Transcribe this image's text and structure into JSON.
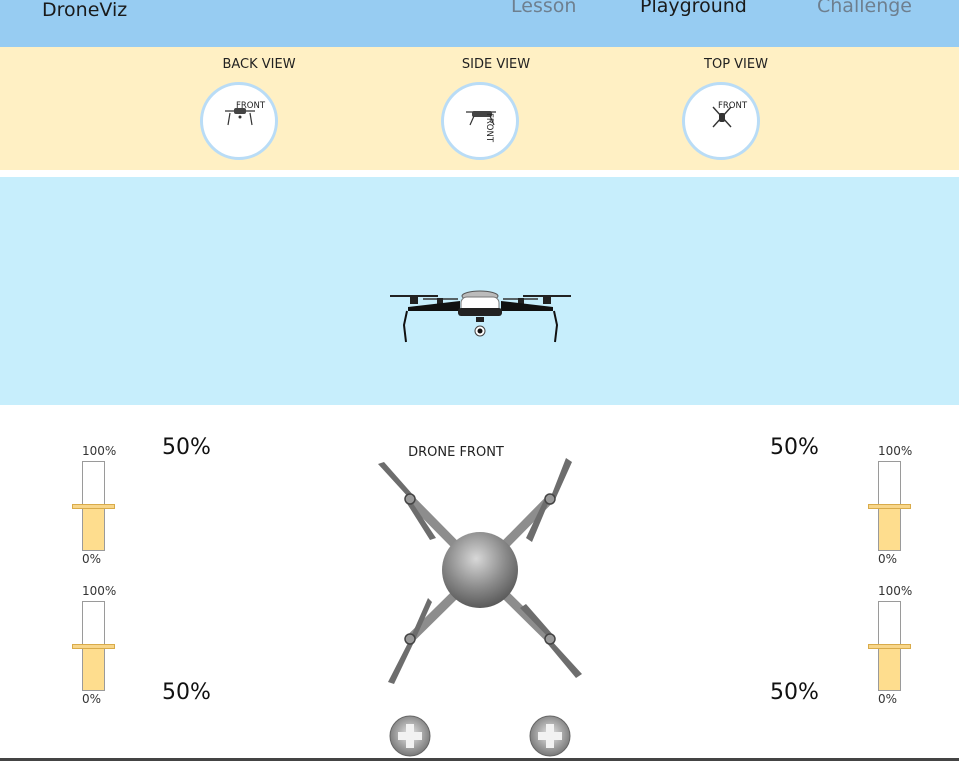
{
  "app": {
    "title": "DroneViz"
  },
  "nav": [
    {
      "label": "Lesson"
    },
    {
      "label": "Playground"
    },
    {
      "label": "Challenge"
    }
  ],
  "active_tab": "Playground",
  "views": {
    "back": {
      "title": "BACK VIEW",
      "front_label": "FRONT"
    },
    "side": {
      "title": "SIDE VIEW",
      "front_label": "FRONT"
    },
    "top": {
      "title": "TOP VIEW",
      "front_label": "FRONT"
    }
  },
  "controls": {
    "drone_front_label": "DRONE FRONT",
    "motors": {
      "front_left": {
        "value": 0.5,
        "percent_label": "50%",
        "max_label": "100%",
        "min_label": "0%"
      },
      "back_left": {
        "value": 0.5,
        "percent_label": "50%",
        "max_label": "100%",
        "min_label": "0%"
      },
      "front_right": {
        "value": 0.5,
        "percent_label": "50%",
        "max_label": "100%",
        "min_label": "0%"
      },
      "back_right": {
        "value": 0.5,
        "percent_label": "50%",
        "max_label": "100%",
        "min_label": "0%"
      }
    }
  },
  "colors": {
    "header": "#97ccf2",
    "views_strip": "#fff0c4",
    "sky": "#c7eefc",
    "slider_fill": "#fedd8e",
    "view_ring": "#b9dcf6"
  }
}
